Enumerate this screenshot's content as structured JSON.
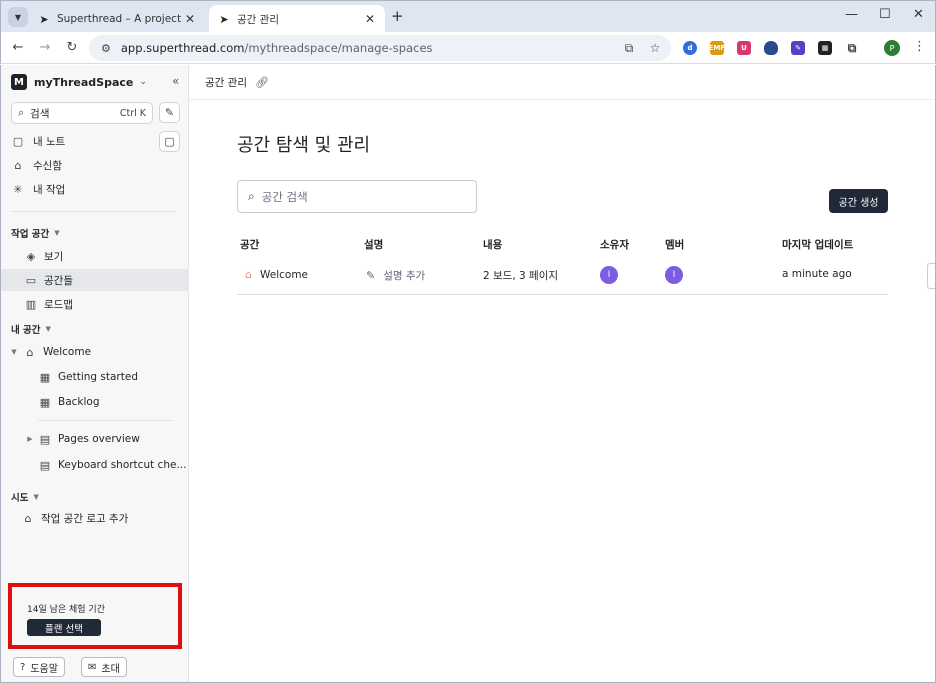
{
  "browser": {
    "tabs": [
      {
        "title": "Superthread – A project mana",
        "active": false
      },
      {
        "title": "공간 관리",
        "active": true
      }
    ],
    "url_host": "app.superthread.com",
    "url_path": "/mythreadspace/manage-spaces",
    "profile_initial": "P",
    "extensions": [
      {
        "name": "d",
        "color": "#2f6fd6"
      },
      {
        "name": "EMP",
        "color": "#d99a14"
      },
      {
        "name": "U",
        "color": "#d63a6a"
      },
      {
        "name": "shield",
        "color": "#2b4a8a"
      },
      {
        "name": "pen",
        "color": "#5a3ec8"
      },
      {
        "name": "grid",
        "color": "#222222"
      },
      {
        "name": "puzzle",
        "color": "#555555"
      }
    ]
  },
  "sidebar": {
    "workspace_initial": "M",
    "workspace_name": "myThreadSpace",
    "search_placeholder": "검색",
    "search_shortcut": "Ctrl K",
    "top_items": [
      {
        "label": "내 노트",
        "icon": "note-icon"
      },
      {
        "label": "수신함",
        "icon": "inbox-icon"
      },
      {
        "label": "내 작업",
        "icon": "tasks-icon"
      }
    ],
    "workspace_section": "작업 공간",
    "workspace_items": [
      {
        "label": "보기",
        "icon": "layers-icon"
      },
      {
        "label": "공간들",
        "icon": "folder-icon",
        "selected": true
      },
      {
        "label": "로드맵",
        "icon": "map-icon"
      }
    ],
    "my_space_section": "내 공간",
    "space_name": "Welcome",
    "boards": [
      {
        "label": "Getting started",
        "icon": "board-icon"
      },
      {
        "label": "Backlog",
        "icon": "board-icon"
      }
    ],
    "pages": [
      {
        "label": "Pages overview",
        "icon": "page-icon"
      },
      {
        "label": "Keyboard shortcut che...",
        "icon": "page-icon"
      }
    ],
    "try_section": "시도",
    "try_items": [
      {
        "label": "작업 공간 로고 추가",
        "icon": "bank-icon"
      }
    ],
    "trial_text": "14일 남은 체험 기간",
    "trial_button": "플랜 선택",
    "help_label": "도움말",
    "invite_label": "초대"
  },
  "main": {
    "breadcrumb": "공간 관리",
    "title": "공간 탐색 및 관리",
    "search_placeholder": "공간 검색",
    "create_button": "공간 생성",
    "columns": [
      "공간",
      "설명",
      "내용",
      "소유자",
      "멤버",
      "마지막 업데이트"
    ],
    "rows": [
      {
        "space": "Welcome",
        "description": "설명 추가",
        "content": "2 보드, 3 페이지",
        "owner_initial": "I",
        "member_initial": "I",
        "updated": "a minute ago"
      }
    ],
    "accent_color": "#7c5ce0"
  }
}
